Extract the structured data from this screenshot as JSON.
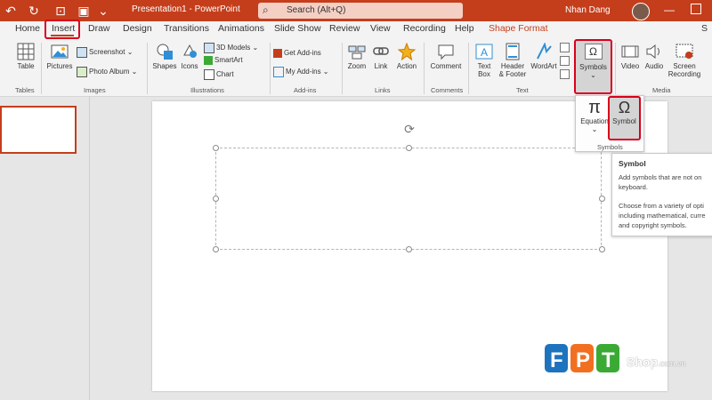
{
  "titlebar": {
    "doc_title": "Presentation1 - PowerPoint",
    "search_placeholder": "Search (Alt+Q)",
    "user_name": "Nhan Dang"
  },
  "tabs": [
    "Home",
    "Insert",
    "Draw",
    "Design",
    "Transitions",
    "Animations",
    "Slide Show",
    "Review",
    "View",
    "Recording",
    "Help",
    "Shape Format"
  ],
  "tab_overflow": "S",
  "ribbon": {
    "tables": {
      "table": "Table",
      "group": "Tables"
    },
    "images": {
      "pictures": "Pictures",
      "screenshot": "Screenshot",
      "photo_album": "Photo Album",
      "group": "Images"
    },
    "illustrations": {
      "shapes": "Shapes",
      "icons": "Icons",
      "models_3d": "3D Models",
      "smartart": "SmartArt",
      "chart": "Chart",
      "group": "Illustrations"
    },
    "addins": {
      "get_addins": "Get Add-ins",
      "my_addins": "My Add-ins",
      "group": "Add-ins"
    },
    "links": {
      "zoom": "Zoom",
      "link": "Link",
      "action": "Action",
      "group": "Links"
    },
    "comments": {
      "comment": "Comment",
      "group": "Comments"
    },
    "text": {
      "text_box_1": "Text",
      "text_box_2": "Box",
      "header_1": "Header",
      "header_2": "& Footer",
      "wordart": "WordArt",
      "group": "Text"
    },
    "symbols": {
      "label": "Symbols",
      "glyph": "Ω"
    },
    "media": {
      "video": "Video",
      "audio": "Audio",
      "screen_rec_1": "Screen",
      "screen_rec_2": "Recording",
      "group": "Media"
    }
  },
  "symbols_dropdown": {
    "equation": "Equation",
    "equation_glyph": "π",
    "symbol": "Symbol",
    "symbol_glyph": "Ω",
    "group": "Symbols"
  },
  "tooltip": {
    "title": "Symbol",
    "line1": "Add symbols that are not on",
    "line2": "keyboard.",
    "line3": "Choose from a variety of opti",
    "line4": "including mathematical, curre",
    "line5": "and copyright symbols."
  },
  "watermark": {
    "brand": "FPT",
    "site": "Shop",
    "domain": ".com.vn"
  },
  "colors": {
    "accent": "#c43e1c",
    "highlight": "#d9001b",
    "fpt_blue": "#1e73be",
    "fpt_orange": "#f26f21",
    "fpt_green": "#3aaa35"
  }
}
